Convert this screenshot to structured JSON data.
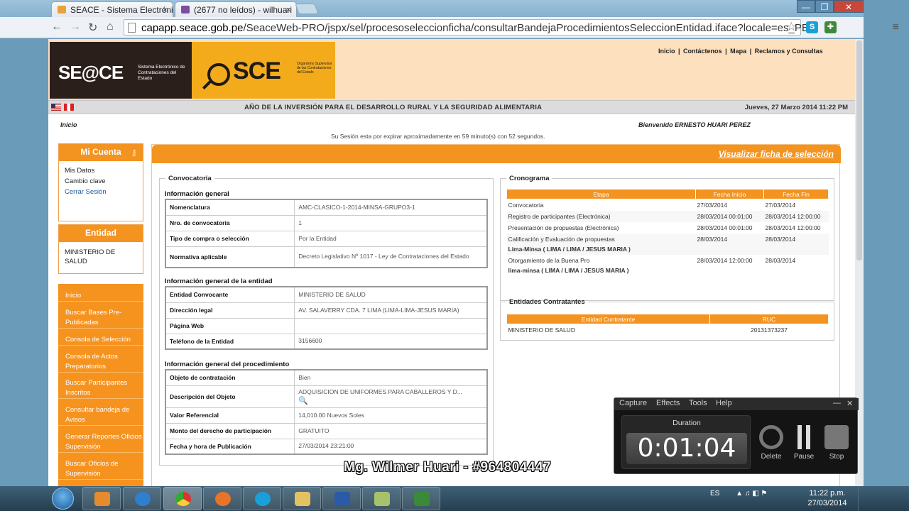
{
  "browser": {
    "tabs": [
      {
        "label": "SEACE - Sistema Electróni",
        "close": "×"
      },
      {
        "label": "(2677 no leídos) - wilhuari",
        "close": "×"
      }
    ],
    "url_host": "capapp.seace.gob.pe",
    "url_path": "/SeaceWeb-PRO/jspx/sel/procesoseleccionficha/consultarBandejaProcedimientosSeleccionEntidad.iface?locale=es_PE",
    "nav": {
      "back": "←",
      "forward": "→",
      "reload": "↻",
      "home": "⌂"
    },
    "star": "☆",
    "window_buttons": [
      "—",
      "❐",
      "✕"
    ]
  },
  "header": {
    "seace_logo": "SE@CE",
    "seace_sub": "Sistema Electrónico de Contrataciones del Estado",
    "osce_logo": "SCE",
    "osce_sub": "Organismo Supervisor de las Contrataciones del Estado",
    "links": [
      "Inicio",
      "Contáctenos",
      "Mapa",
      "Reclamos y Consultas"
    ]
  },
  "band": {
    "year_text": "AÑO DE LA INVERSIÓN PARA EL DESARROLLO RURAL Y LA SEGURIDAD ALIMENTARIA",
    "date_text": "Jueves, 27 Marzo 2014 11:22 PM"
  },
  "page": {
    "breadcrumb": "Inicio",
    "welcome": "Bienvenido  ERNESTO HUARI PEREZ",
    "session": "Su Sesión esta por expirar aproximadamente en 59 minuto(s) con 52 segundos."
  },
  "sidebar": {
    "cuenta_title": "Mi Cuenta",
    "cuenta_items": [
      "Mis Datos",
      "Cambio clave"
    ],
    "logout": "Cerrar Sesión",
    "entidad_title": "Entidad",
    "entidad_name": "MINISTERIO DE SALUD",
    "menu": [
      "Inicio",
      "Buscar Bases Pre-Publicadas",
      "Consola de Selección",
      "Consola de Actos Preparatorios",
      "Buscar Participantes Inscritos",
      "Consultar bandeja de Avisos",
      "Generar Reportes Oficios Supervisión",
      "Buscar Oficios de Supervisión"
    ]
  },
  "main": {
    "link": "Visualizar ficha de selección",
    "convocatoria_legend": "Convocatoria",
    "info_general_title": "Información general",
    "info_general": [
      [
        "Nomenclatura",
        "AMC-CLASICO-1-2014-MINSA-GRUPO3-1"
      ],
      [
        "Nro. de convocatoria",
        "1"
      ],
      [
        "Tipo de compra o selección",
        "Por la Entidad"
      ],
      [
        "Normativa aplicable",
        "Decreto Legislativo Nº 1017 - Ley de Contrataciones del Estado"
      ]
    ],
    "entidad_title": "Información general de la entidad",
    "entidad": [
      [
        "Entidad Convocante",
        "MINISTERIO DE SALUD"
      ],
      [
        "Dirección legal",
        "AV. SALAVERRY CDA. 7 LIMA (LIMA-LIMA-JESUS MARIA)"
      ],
      [
        "Página Web",
        ""
      ],
      [
        "Teléfono de la Entidad",
        "3156600"
      ]
    ],
    "procedimiento_title": "Información general del procedimiento",
    "procedimiento": [
      [
        "Objeto de contratación",
        "Bien"
      ],
      [
        "Descripción del Objeto",
        "ADQUISICION DE UNIFORMES PARA CABALLEROS Y D..."
      ],
      [
        "Valor Referencial",
        "14,010.00 Nuevos Soles"
      ],
      [
        "Monto del derecho de participación",
        "GRATUITO"
      ],
      [
        "Fecha y hora de Publicación",
        "27/03/2014 23:21:00"
      ]
    ],
    "cronograma_legend": "Cronograma",
    "cronograma_headers": [
      "Etapa",
      "Fecha Inicio",
      "Fecha Fin"
    ],
    "cronograma": [
      [
        "Convocatoria",
        "27/03/2014",
        "27/03/2014"
      ],
      [
        "Registro de participantes (Electrónica)",
        "28/03/2014 00:01:00",
        "28/03/2014 12:00:00"
      ],
      [
        "Presentación de propuestas (Electrónica)",
        "28/03/2014 00:01:00",
        "28/03/2014 12:00:00"
      ],
      [
        "Calificación y Evaluación de propuestas",
        "28/03/2014",
        "28/03/2014"
      ],
      [
        "Otorgamiento de la Buena Pro",
        "28/03/2014 12:00:00",
        "28/03/2014"
      ]
    ],
    "crono_bold": [
      "Lima-Minsa ( LIMA / LIMA / JESUS MARIA )",
      "lima-minsa ( LIMA / LIMA / JESUS MARIA )"
    ],
    "contratantes_legend": "Entidades Contratantes",
    "contratantes_headers": [
      "Entidad Contratante",
      "RUC"
    ],
    "contratantes": [
      [
        "MINISTERIO DE SALUD",
        "20131373237"
      ]
    ]
  },
  "recorder": {
    "menu": [
      "Capture",
      "Effects",
      "Tools",
      "Help"
    ],
    "duration_label": "Duration",
    "duration": "0:01:04",
    "buttons": [
      "Delete",
      "Pause",
      "Stop"
    ]
  },
  "overlay": "Mg. Wilmer Huari - #964804447",
  "taskbar": {
    "lang": "ES",
    "time": "11:22 p.m.",
    "date": "27/03/2014"
  }
}
